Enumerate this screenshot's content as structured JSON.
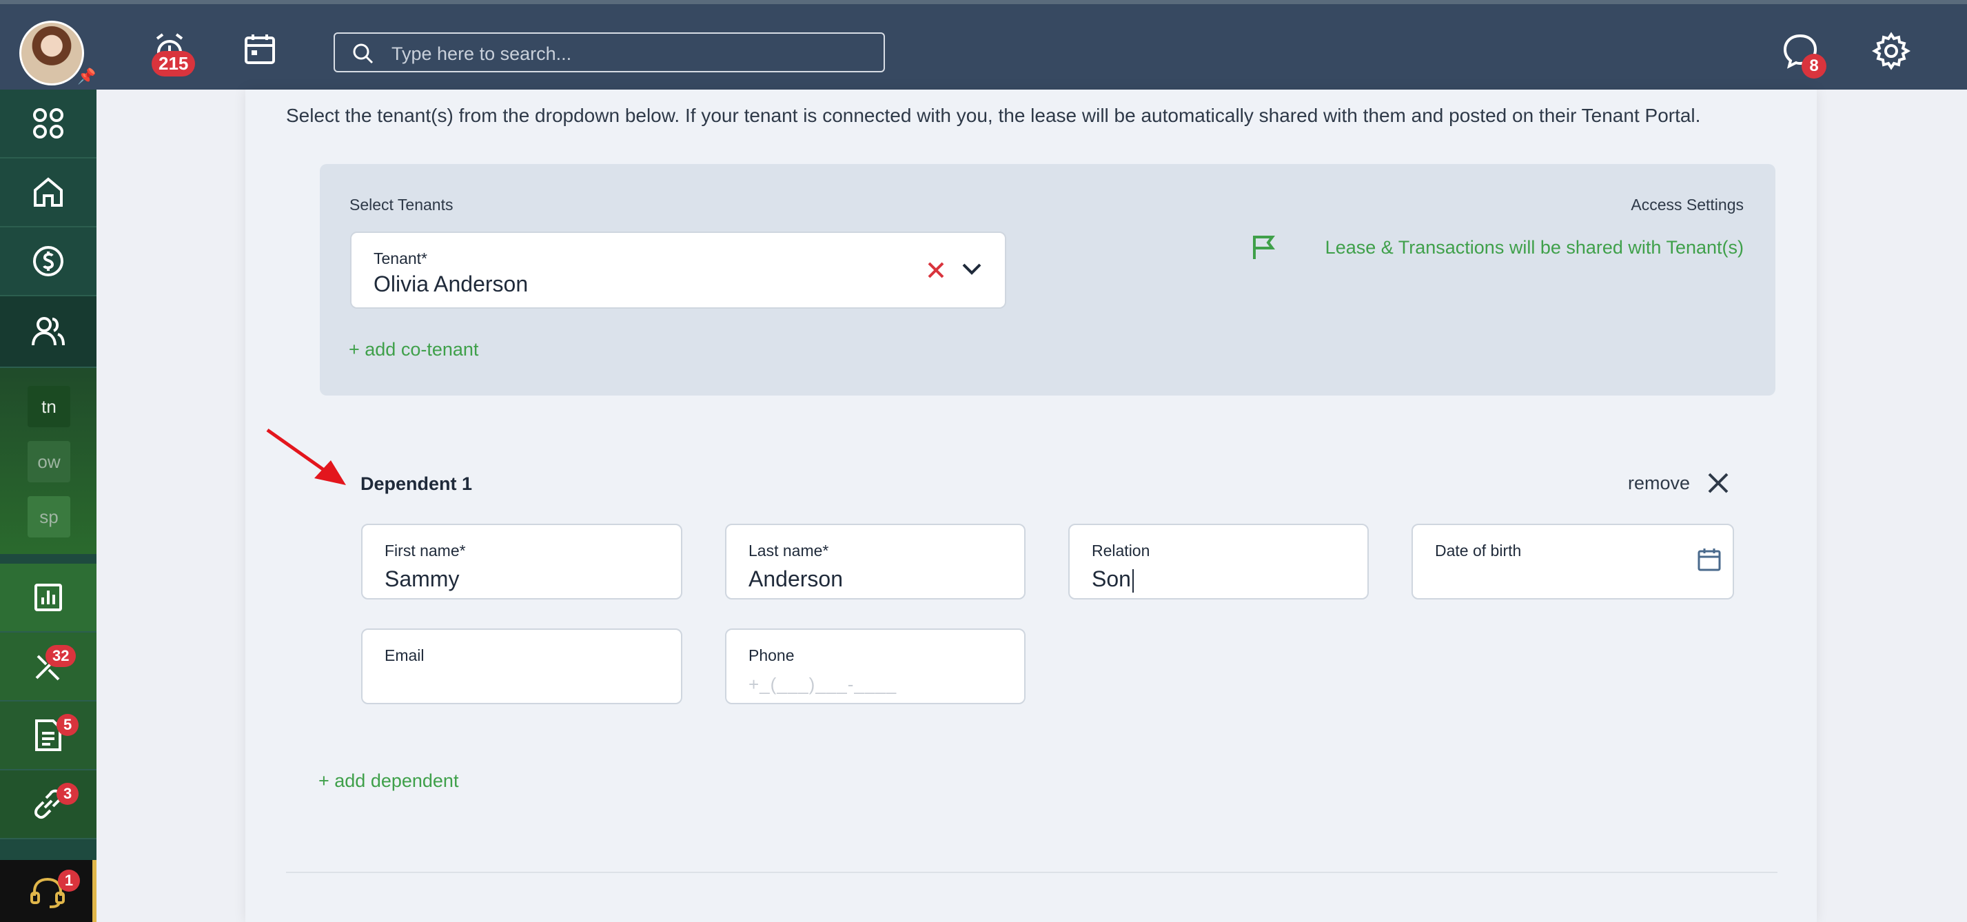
{
  "header": {
    "alarm_badge": "215",
    "search_placeholder": "Type here to search...",
    "messages_badge": "8"
  },
  "sidebar": {
    "chips": [
      "tn",
      "ow",
      "sp"
    ],
    "maintenance_badge": "32",
    "documents_badge": "5",
    "links_badge": "3",
    "support_badge": "1"
  },
  "main": {
    "intro": "Select the tenant(s) from the dropdown below. If your tenant is connected with you, the lease will be automatically shared with them and posted on their Tenant Portal.",
    "select_tenants_label": "Select Tenants",
    "access_settings_label": "Access Settings",
    "access_text": "Lease & Transactions will be shared with Tenant(s)",
    "tenant_field_label": "Tenant*",
    "tenant_value": "Olivia Anderson",
    "add_cotenant": "+ add co-tenant",
    "dependent_title": "Dependent 1",
    "remove_label": "remove",
    "fields": {
      "first_name_label": "First name*",
      "first_name_value": "Sammy",
      "last_name_label": "Last name*",
      "last_name_value": "Anderson",
      "relation_label": "Relation",
      "relation_value": "Son",
      "dob_label": "Date of birth",
      "email_label": "Email",
      "phone_label": "Phone",
      "phone_placeholder": "+_(___)___-____"
    },
    "add_dependent": "+ add dependent"
  },
  "colors": {
    "topbar": "#374961",
    "sidebar": "#1e4a3f",
    "accent_green": "#3fa04a",
    "badge_red": "#d9343d",
    "annotation_arrow": "#e3161d"
  }
}
